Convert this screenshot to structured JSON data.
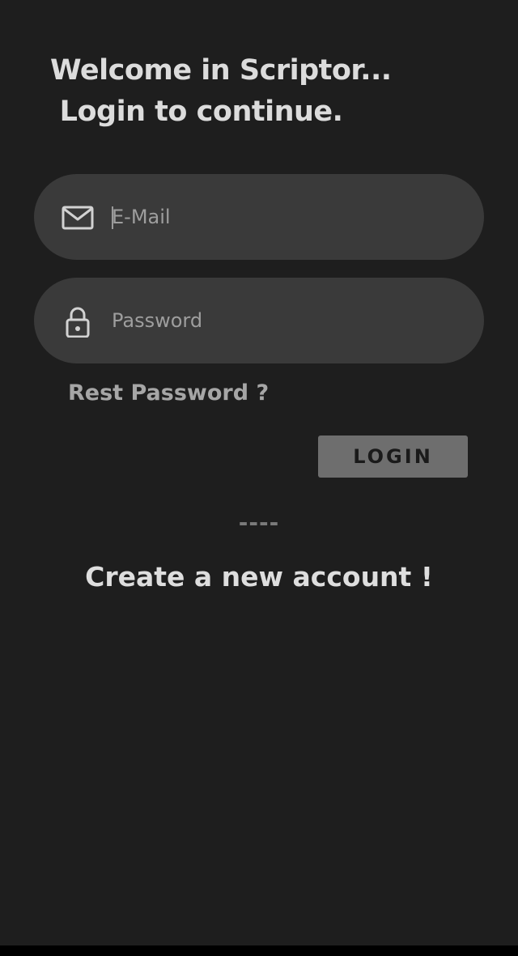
{
  "header": {
    "title": "Welcome in Scriptor...\n Login to continue."
  },
  "form": {
    "email": {
      "placeholder": "E-Mail",
      "value": "",
      "icon": "mail-icon"
    },
    "password": {
      "placeholder": "Password",
      "value": "",
      "icon": "lock-icon"
    },
    "reset_label": "Rest Password ?",
    "login_label": "LOGIN"
  },
  "footer": {
    "divider_text": "----",
    "create_account_label": "Create a new account !"
  },
  "colors": {
    "background": "#1e1e1e",
    "field_background": "#3a3a3a",
    "button_background": "#6e6e6e",
    "title_text": "#dcdcdc",
    "muted_text": "#a6a6a6"
  }
}
